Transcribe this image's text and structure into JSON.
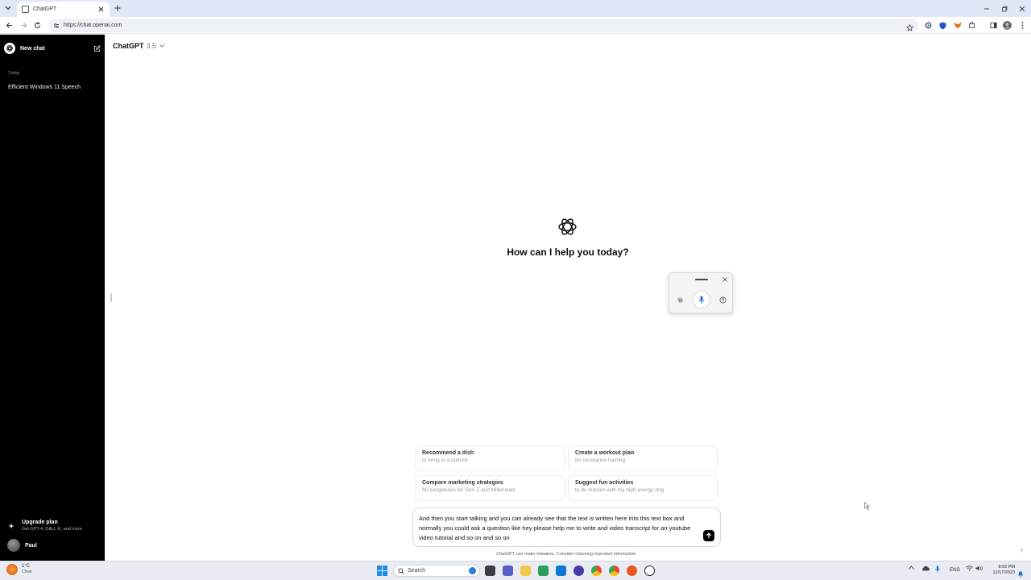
{
  "browser": {
    "tab_title": "ChatGPT",
    "url": "https://chat.openai.com"
  },
  "sidebar": {
    "new_chat_label": "New chat",
    "section_today": "Today",
    "history": [
      {
        "label": "Efficient Windows 11 Speech"
      }
    ],
    "upgrade_title": "Upgrade plan",
    "upgrade_subtitle": "Get GPT-4, DALL·E, and more",
    "user_name": "Paul"
  },
  "header": {
    "model_name": "ChatGPT",
    "model_version": "3.5"
  },
  "main": {
    "greeting": "How can I help you today?",
    "suggestions": [
      {
        "title": "Recommend a dish",
        "subtitle": "to bring to a potluck"
      },
      {
        "title": "Create a workout plan",
        "subtitle": "for resistance training"
      },
      {
        "title": "Compare marketing strategies",
        "subtitle": "for sunglasses for Gen Z and Millennials"
      },
      {
        "title": "Suggest fun activities",
        "subtitle": "to do indoors with my high-energy dog"
      }
    ],
    "composer_text": "And then you start talking and you can already see that the text is written here into this text box and normally you could ask a question like hey please help me to write and video transcript for an youtube video tutorial and so on and so on",
    "disclaimer": "ChatGPT can make mistakes. Consider checking important information.",
    "help_label": "?"
  },
  "taskbar": {
    "weather_temp": "1°C",
    "weather_condition": "Clear",
    "search_label": "Search",
    "language": "ENG",
    "time": "8:02 PM",
    "date": "12/17/2023"
  },
  "colors": {
    "sidebar_bg": "#000000",
    "tabbar_bg": "#dfe8f6",
    "send_button": "#000000",
    "windows_accent": "#1c8ee8"
  },
  "icons": {
    "openai_logo": "openai-logo-icon",
    "voice_mic": "microphone-icon",
    "voice_settings": "gear-icon",
    "voice_help": "help-icon",
    "send": "arrow-up-icon"
  }
}
